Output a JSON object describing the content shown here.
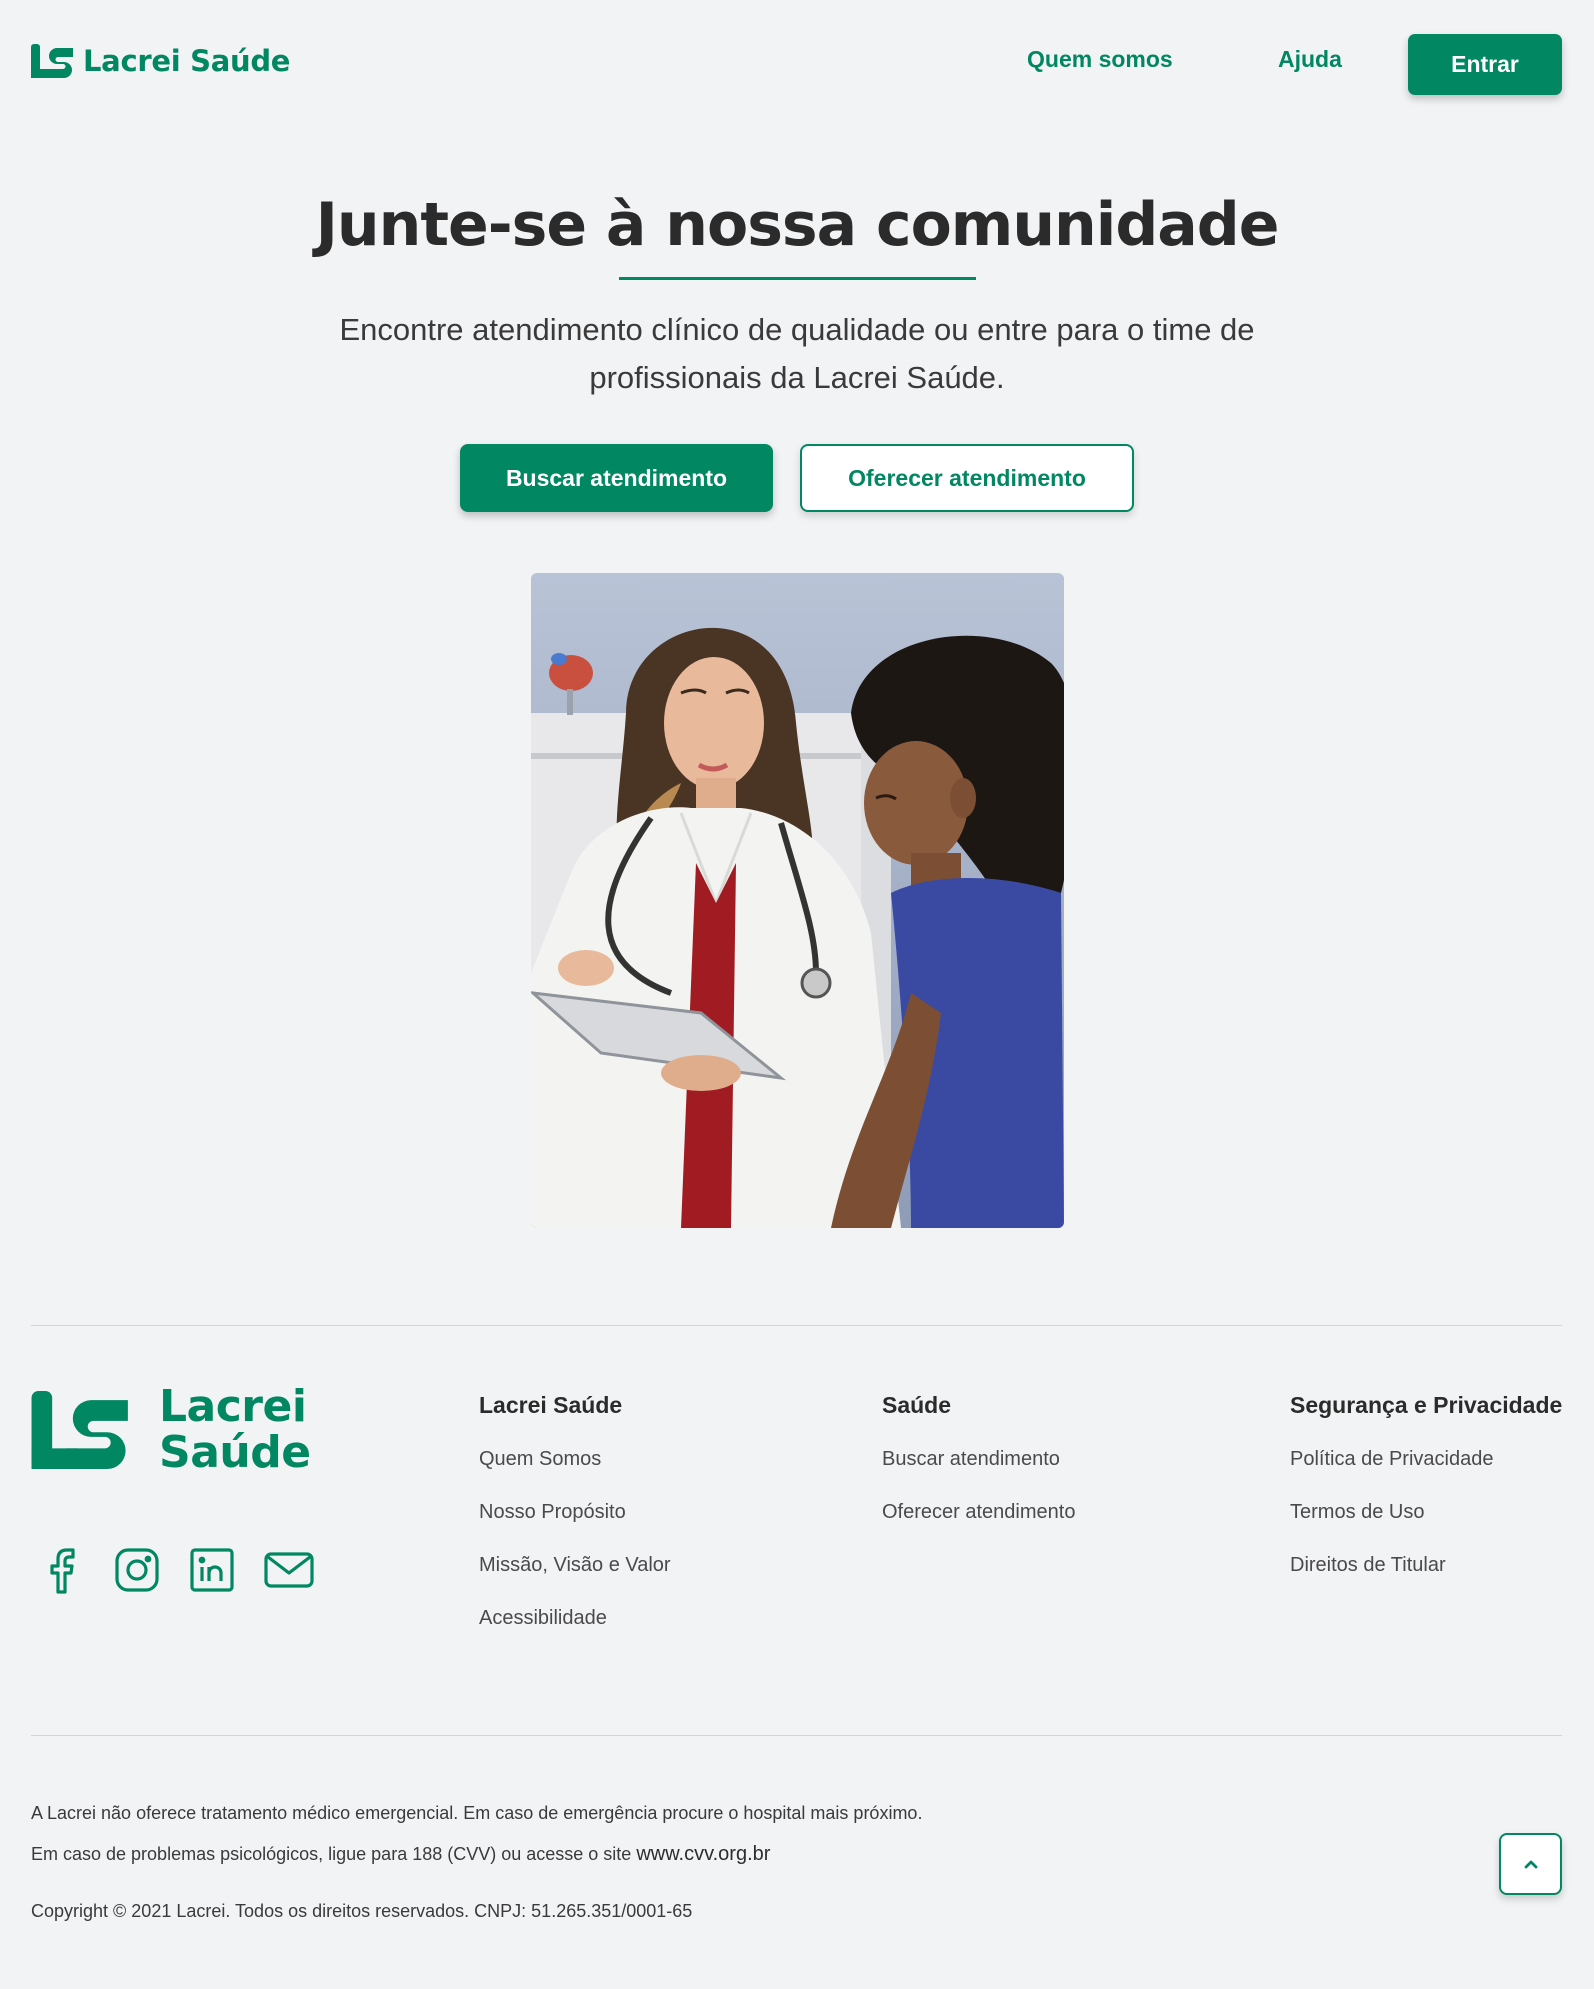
{
  "brand": {
    "name": "Lacrei Saúde",
    "name_line1": "Lacrei",
    "name_line2": "Saúde",
    "color": "#018762"
  },
  "header": {
    "nav": [
      "Quem somos",
      "Ajuda"
    ],
    "login_label": "Entrar"
  },
  "hero": {
    "title": "Junte-se à nossa comunidade",
    "subtitle": "Encontre atendimento clínico de qualidade ou entre para o time de profissionais da Lacrei Saúde.",
    "primary_cta": "Buscar atendimento",
    "secondary_cta": "Oferecer atendimento",
    "image": "doctor-with-patient-photo"
  },
  "footer": {
    "socials": [
      "facebook-icon",
      "instagram-icon",
      "linkedin-icon",
      "mail-icon"
    ],
    "columns": [
      {
        "title": "Lacrei Saúde",
        "links": [
          "Quem Somos",
          "Nosso Propósito",
          "Missão, Visão e Valor",
          "Acessibilidade"
        ]
      },
      {
        "title": "Saúde",
        "links": [
          "Buscar atendimento",
          "Oferecer atendimento"
        ]
      },
      {
        "title": "Segurança e Privacidade",
        "links": [
          "Política de Privacidade",
          "Termos de Uso",
          "Direitos de Titular"
        ]
      }
    ],
    "notice_1": "A Lacrei não oferece tratamento médico emergencial. Em caso de emergência procure o hospital mais próximo.",
    "notice_2_prefix": "Em caso de problemas psicológicos, ligue para 188 (CVV) ou acesse o site ",
    "notice_2_site": "www.cvv.org.br",
    "copyright": "Copyright © 2021 Lacrei. Todos os direitos reservados. CNPJ: 51.265.351/0001-65",
    "scroll_top_icon": "chevron-up-icon"
  }
}
